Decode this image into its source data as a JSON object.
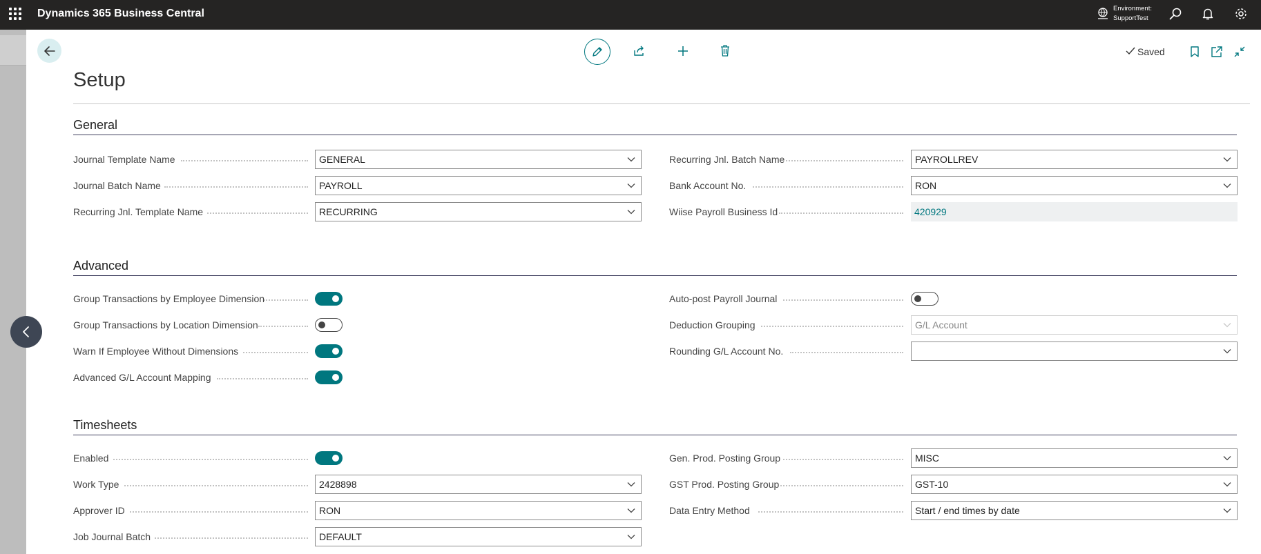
{
  "app": {
    "title": "Dynamics 365 Business Central"
  },
  "topbar": {
    "environment_label": "Environment:",
    "environment_name": "SupportTest",
    "icons": [
      "waffle-icon",
      "environment-icon",
      "search-icon",
      "bell-icon",
      "gear-icon"
    ]
  },
  "toolbar": {
    "status": "Saved",
    "actions": [
      "edit-icon",
      "share-icon",
      "plus-icon",
      "trash-icon",
      "bookmark-icon",
      "open-new-window-icon",
      "collapse-icon"
    ]
  },
  "page": {
    "title": "Setup"
  },
  "sections": {
    "general": {
      "title": "General",
      "fields": {
        "journal_template_name": {
          "label": "Journal Template Name",
          "value": "GENERAL"
        },
        "journal_batch_name": {
          "label": "Journal Batch Name",
          "value": "PAYROLL"
        },
        "recurring_template_name": {
          "label": "Recurring Jnl. Template Name",
          "value": "RECURRING"
        },
        "recurring_batch_name": {
          "label": "Recurring Jnl. Batch Name",
          "value": "PAYROLLREV"
        },
        "bank_account_no": {
          "label": "Bank Account No.",
          "value": "RON"
        },
        "wiise_business_id": {
          "label": "Wiise Payroll Business Id",
          "value": "420929"
        }
      }
    },
    "advanced": {
      "title": "Advanced",
      "fields": {
        "group_by_employee_dim": {
          "label": "Group Transactions by Employee Dimension",
          "on": true
        },
        "group_by_location_dim": {
          "label": "Group Transactions by Location Dimension",
          "on": false
        },
        "warn_employee_without_dims": {
          "label": "Warn If Employee Without Dimensions",
          "on": true
        },
        "advanced_gl_mapping": {
          "label": "Advanced G/L Account Mapping",
          "on": true
        },
        "auto_post_journal": {
          "label": "Auto-post Payroll Journal",
          "on": false
        },
        "deduction_grouping": {
          "label": "Deduction Grouping",
          "value": "G/L Account"
        },
        "rounding_gl_account": {
          "label": "Rounding G/L Account No.",
          "value": ""
        }
      }
    },
    "timesheets": {
      "title": "Timesheets",
      "fields": {
        "enabled": {
          "label": "Enabled",
          "on": true
        },
        "work_type": {
          "label": "Work Type",
          "value": "2428898"
        },
        "approver_id": {
          "label": "Approver ID",
          "value": "RON"
        },
        "job_journal_batch": {
          "label": "Job Journal Batch",
          "value": "DEFAULT"
        },
        "gen_prod_posting_group": {
          "label": "Gen. Prod. Posting Group",
          "value": "MISC"
        },
        "gst_prod_posting_group": {
          "label": "GST Prod. Posting Group",
          "value": "GST-10"
        },
        "data_entry_method": {
          "label": "Data Entry Method",
          "value": "Start / end times by date"
        }
      }
    }
  },
  "colors": {
    "accent": "#00777f",
    "topbar": "#252423",
    "toggle_on": "#00777f"
  }
}
